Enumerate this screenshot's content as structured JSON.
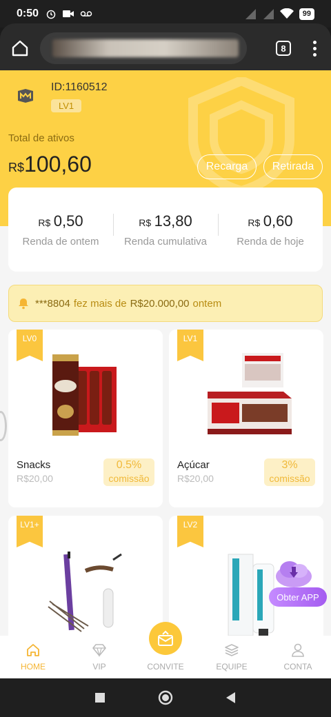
{
  "status_bar": {
    "time": "0:50",
    "battery": "99"
  },
  "browser": {
    "tab_count": "8"
  },
  "account": {
    "id_label": "ID:1160512",
    "level": "LV1",
    "assets_label": "Total de ativos",
    "assets_currency": "R$",
    "assets_value": "100,60",
    "recarga_label": "Recarga",
    "retirada_label": "Retirada"
  },
  "stats": [
    {
      "currency": "R$",
      "value": "0,50",
      "label": "Renda de ontem"
    },
    {
      "currency": "R$",
      "value": "13,80",
      "label": "Renda cumulativa"
    },
    {
      "currency": "R$",
      "value": "0,60",
      "label": "Renda de hoje"
    }
  ],
  "notice": {
    "user": "***8804",
    "text_a": "fez mais de",
    "amount": "R$20.000,00",
    "text_b": "ontem"
  },
  "products": [
    {
      "level": "LV0",
      "name": "Snacks",
      "price": "R$20,00",
      "commission": "0.5%",
      "commission_word": "comissão"
    },
    {
      "level": "LV1",
      "name": "Açúcar",
      "price": "R$20,00",
      "commission": "3%",
      "commission_word": "comissão"
    },
    {
      "level": "LV1+"
    },
    {
      "level": "LV2"
    }
  ],
  "obter_app": "Obter APP",
  "bottom_nav": [
    {
      "label": "HOME",
      "icon": "home-icon",
      "active": true
    },
    {
      "label": "VIP",
      "icon": "diamond-icon"
    },
    {
      "label": "CONVITE",
      "icon": "invite-icon"
    },
    {
      "label": "EQUIPE",
      "icon": "layers-icon"
    },
    {
      "label": "CONTA",
      "icon": "user-icon"
    }
  ],
  "colors": {
    "primary": "#fdd145",
    "accent": "#f5b533",
    "commission_bg": "#fdf0c6"
  }
}
